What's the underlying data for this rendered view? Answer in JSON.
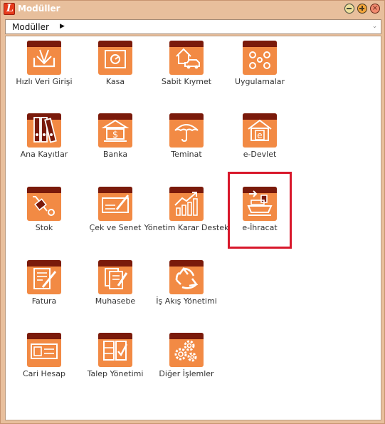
{
  "window": {
    "title": "Modüller"
  },
  "selector": {
    "label": "Modüller"
  },
  "colors": {
    "tile_top": "#7a1a0b",
    "tile_body": "#f28a44",
    "highlight": "#d8182b"
  },
  "modules": [
    {
      "label": "Hızlı Veri Girişi",
      "icon": "download-tray-icon"
    },
    {
      "label": "Kasa",
      "icon": "safe-icon"
    },
    {
      "label": "Sabit Kıymet",
      "icon": "house-car-icon"
    },
    {
      "label": "Uygulamalar",
      "icon": "apps-circles-icon"
    },
    {
      "label": "Ana Kayıtlar",
      "icon": "binders-icon"
    },
    {
      "label": "Banka",
      "icon": "bank-icon"
    },
    {
      "label": "Teminat",
      "icon": "umbrella-icon"
    },
    {
      "label": "e-Devlet",
      "icon": "e-gov-house-icon"
    },
    {
      "label": "Stok",
      "icon": "hand-truck-icon"
    },
    {
      "label": "Çek ve Senet",
      "icon": "cheque-icon"
    },
    {
      "label": "Yönetim Karar Destek",
      "icon": "rising-chart-icon"
    },
    {
      "label": "e-İhracat",
      "icon": "export-ship-icon"
    },
    {
      "label": "Fatura",
      "icon": "invoice-pen-icon"
    },
    {
      "label": "Muhasebe",
      "icon": "accounting-docs-icon"
    },
    {
      "label": "İş Akış Yönetimi",
      "icon": "recycle-arrows-icon"
    },
    {
      "label": "Cari Hesap",
      "icon": "id-card-icon"
    },
    {
      "label": "Talep Yönetimi",
      "icon": "request-checklist-icon"
    },
    {
      "label": "Diğer İşlemler",
      "icon": "gears-icon"
    }
  ]
}
